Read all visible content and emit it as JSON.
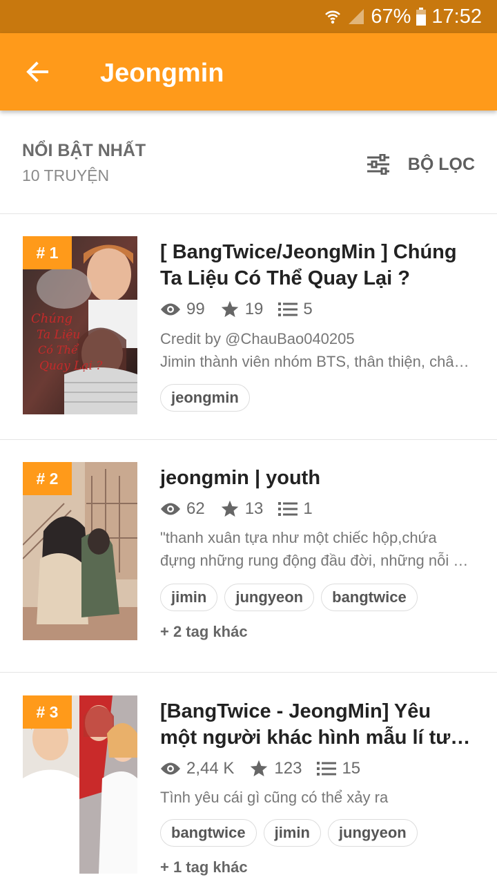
{
  "status_bar": {
    "battery": "67%",
    "time": "17:52"
  },
  "app_bar": {
    "title": "Jeongmin"
  },
  "sort_bar": {
    "title": "NỔI BẬT NHẤT",
    "count": "10 TRUYỆN",
    "filter_label": "BỘ LỌC"
  },
  "stories": [
    {
      "rank": "# 1",
      "title_lines": [
        "[ BangTwice/JeongMin ] Chúng",
        "Ta Liệu Có Thể Quay Lại ?"
      ],
      "views": "99",
      "votes": "19",
      "parts": "5",
      "desc_lines": [
        "Credit by @ChauBao040205",
        "Jimin thành viên nhóm BTS, thân thiện, chân thật"
      ],
      "tags": [
        "jeongmin"
      ],
      "cover_text": [
        "Chúng",
        "Ta Liệu",
        "Có Thể",
        "Quay Lại ?"
      ]
    },
    {
      "rank": "# 2",
      "title_lines": [
        "jeongmin | youth"
      ],
      "views": "62",
      "votes": "13",
      "parts": "1",
      "desc_lines": [
        "\"thanh xuân tựa như một chiếc hộp,chứa",
        "đựng những rung động đầu đời, những nỗi nhớ"
      ],
      "tags": [
        "jimin",
        "jungyeon",
        "bangtwice"
      ],
      "more_tags": "+ 2 tag khác"
    },
    {
      "rank": "# 3",
      "title_lines": [
        "[BangTwice - JeongMin] Yêu",
        "một người khác hình mẫu lí tưởng"
      ],
      "views": "2,44 K",
      "votes": "123",
      "parts": "15",
      "desc_lines": [
        "Tình yêu cái gì cũng có thể xảy ra"
      ],
      "tags": [
        "bangtwice",
        "jimin",
        "jungyeon"
      ],
      "more_tags": "+ 1 tag khác"
    }
  ]
}
